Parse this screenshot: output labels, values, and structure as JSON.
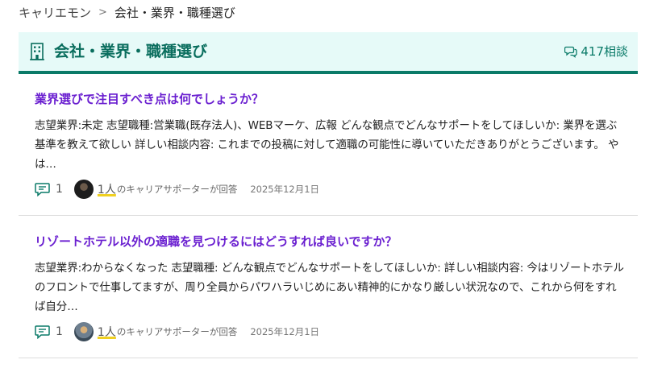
{
  "breadcrumb": {
    "home": "キャリエモン",
    "separator": ">",
    "current": "会社・業界・職種選び"
  },
  "header": {
    "title": "会社・業界・職種選び",
    "consult_count": "417相談",
    "icon": "building-icon",
    "count_icon": "speech-bubbles-icon"
  },
  "questions": [
    {
      "title": "業界選びで注目すべき点は何でしょうか？",
      "body": "志望業界:未定 志望職種:営業職(既存法人)、WEBマーケ、広報 どんな観点でどんなサポートをしてほしいか: 業界を選ぶ基準を教えて欲しい 詳しい相談内容: これまでの投稿に対して適職の可能性に導いていただきありがとうございます。 やは…",
      "comments": "1",
      "answerers": "1人",
      "answer_suffix": "のキャリアサポーターが回答",
      "date": "2025年12月1日"
    },
    {
      "title": "リゾートホテル以外の適職を見つけるにはどうすれば良いですか？",
      "body": "志望業界:わからなくなった 志望職種: どんな観点でどんなサポートをしてほしいか: 詳しい相談内容: 今はリゾートホテルのフロントで仕事してますが、周り全員からパワハラいじめにあい精神的にかなり厳しい状況なので、これから何をすれば自分…",
      "comments": "1",
      "answerers": "1人",
      "answer_suffix": "のキャリアサポーターが回答",
      "date": "2025年12月1日"
    }
  ],
  "colors": {
    "accent_green": "#0a7a68",
    "header_bg": "#e6faf8",
    "title_purple": "#6a1fd0",
    "underline_yellow": "#f0d020"
  }
}
